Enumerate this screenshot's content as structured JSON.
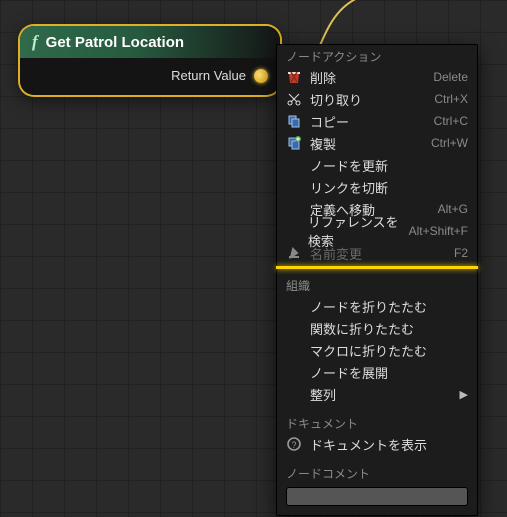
{
  "node": {
    "title": "Get Patrol Location",
    "fx_label": "f",
    "pin_label": "Return Value"
  },
  "menu": {
    "sections": {
      "node_actions": "ノードアクション",
      "organization": "組織",
      "document": "ドキュメント",
      "node_comment": "ノードコメント"
    },
    "items": {
      "delete": {
        "label": "削除",
        "shortcut": "Delete"
      },
      "cut": {
        "label": "切り取り",
        "shortcut": "Ctrl+X"
      },
      "copy": {
        "label": "コピー",
        "shortcut": "Ctrl+C"
      },
      "duplicate": {
        "label": "複製",
        "shortcut": "Ctrl+W"
      },
      "refresh": {
        "label": "ノードを更新",
        "shortcut": ""
      },
      "break_links": {
        "label": "リンクを切断",
        "shortcut": ""
      },
      "goto_def": {
        "label": "定義へ移動",
        "shortcut": "Alt+G"
      },
      "find_refs": {
        "label": "リファレンスを検索",
        "shortcut": "Alt+Shift+F"
      },
      "rename": {
        "label": "名前変更",
        "shortcut": "F2"
      },
      "collapse_node": {
        "label": "ノードを折りたたむ",
        "shortcut": ""
      },
      "collapse_func": {
        "label": "関数に折りたたむ",
        "shortcut": ""
      },
      "collapse_macro": {
        "label": "マクロに折りたたむ",
        "shortcut": ""
      },
      "expand_node": {
        "label": "ノードを展開",
        "shortcut": ""
      },
      "alignment": {
        "label": "整列",
        "shortcut": ""
      },
      "show_doc": {
        "label": "ドキュメントを表示",
        "shortcut": ""
      }
    },
    "comment_input": {
      "value": "",
      "placeholder": ""
    }
  }
}
